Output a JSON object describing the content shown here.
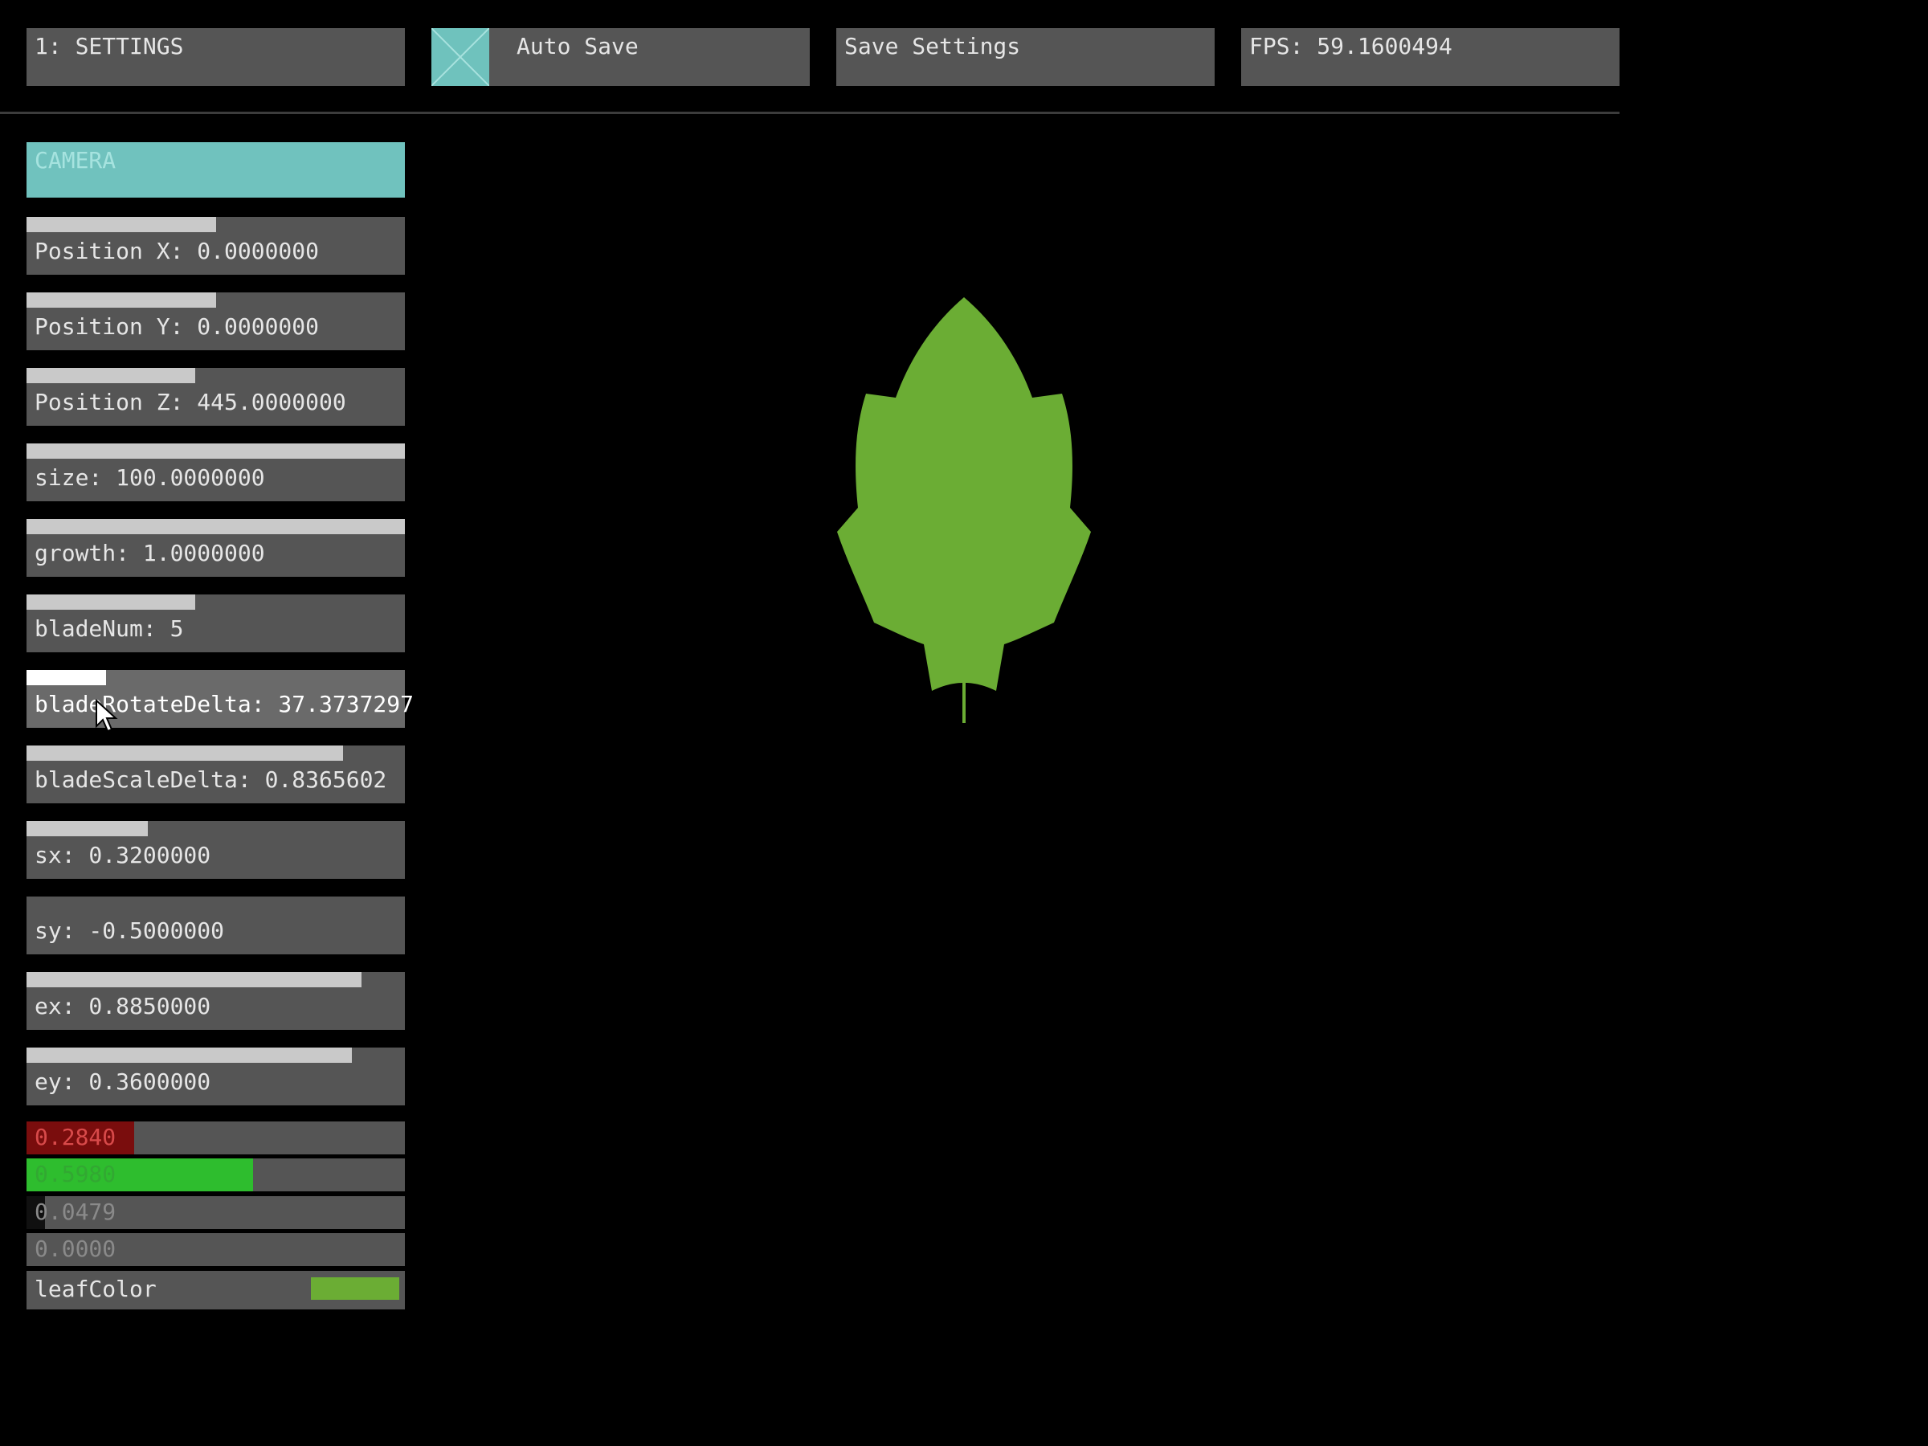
{
  "toolbar": {
    "settings_label": "1: SETTINGS",
    "auto_save_label": "Auto Save",
    "auto_save_checked": true,
    "save_settings_label": "Save Settings",
    "fps_label": "FPS: 59.1600494"
  },
  "panel": {
    "title": "CAMERA",
    "sliders": [
      {
        "label": "Position X: 0.0000000",
        "fill": 0.5
      },
      {
        "label": "Position Y: 0.0000000",
        "fill": 0.5
      },
      {
        "label": "Position Z: 445.0000000",
        "fill": 0.445
      },
      {
        "label": "size: 100.0000000",
        "fill": 1.0
      },
      {
        "label": "growth: 1.0000000",
        "fill": 1.0
      },
      {
        "label": "bladeNum: 5",
        "fill": 0.445
      },
      {
        "label": "bladeRotateDelta: 37.3737297",
        "fill": 0.21
      },
      {
        "label": "bladeScaleDelta: 0.8365602",
        "fill": 0.836
      },
      {
        "label": "sx: 0.3200000",
        "fill": 0.32
      },
      {
        "label": "sy: -0.5000000",
        "fill": 0.0
      },
      {
        "label": "ex: 0.8850000",
        "fill": 0.885
      },
      {
        "label": "ey: 0.3600000",
        "fill": 0.86
      }
    ],
    "color_channels": [
      {
        "label": "0.2840",
        "fill": 0.284,
        "color": "#7a0d0d",
        "text_color": "#d84a4a"
      },
      {
        "label": "0.5980",
        "fill": 0.598,
        "color": "#2ebd2e",
        "text_color": "#32a832"
      },
      {
        "label": "0.0479",
        "fill": 0.048,
        "color": "#101010",
        "text_color": "#8a8a8a"
      },
      {
        "label": "0.0000",
        "fill": 0.0,
        "color": "#333333",
        "text_color": "#8a8a8a"
      }
    ],
    "leaf_color_label": "leafColor",
    "leaf_color": "#6bad34"
  },
  "viewport": {
    "leaf_fill": "#6bad34",
    "background": "#000000"
  }
}
